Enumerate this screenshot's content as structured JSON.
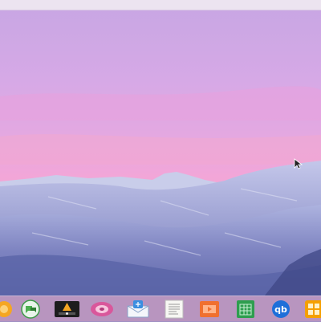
{
  "desktop": {
    "topbar": {
      "title": ""
    },
    "dock": {
      "items": [
        {
          "icon": "orange-circle-icon",
          "color": "#f5a623"
        },
        {
          "icon": "green-speech-bubbles-icon",
          "color": "#4caf50"
        },
        {
          "icon": "media-player-icon",
          "color": "#222222"
        },
        {
          "icon": "pink-disc-icon",
          "color": "#d9579b"
        },
        {
          "icon": "mail-icon",
          "color": "#3b8fe0"
        },
        {
          "icon": "document-viewer-icon",
          "color": "#f2f2f2"
        },
        {
          "icon": "presentation-icon",
          "color": "#f07030"
        },
        {
          "icon": "spreadsheet-icon",
          "color": "#2e9e4f"
        },
        {
          "icon": "qbittorrent-icon",
          "color": "#1e6fd9"
        },
        {
          "icon": "orange-grid-icon",
          "color": "#f5a000"
        }
      ]
    }
  }
}
